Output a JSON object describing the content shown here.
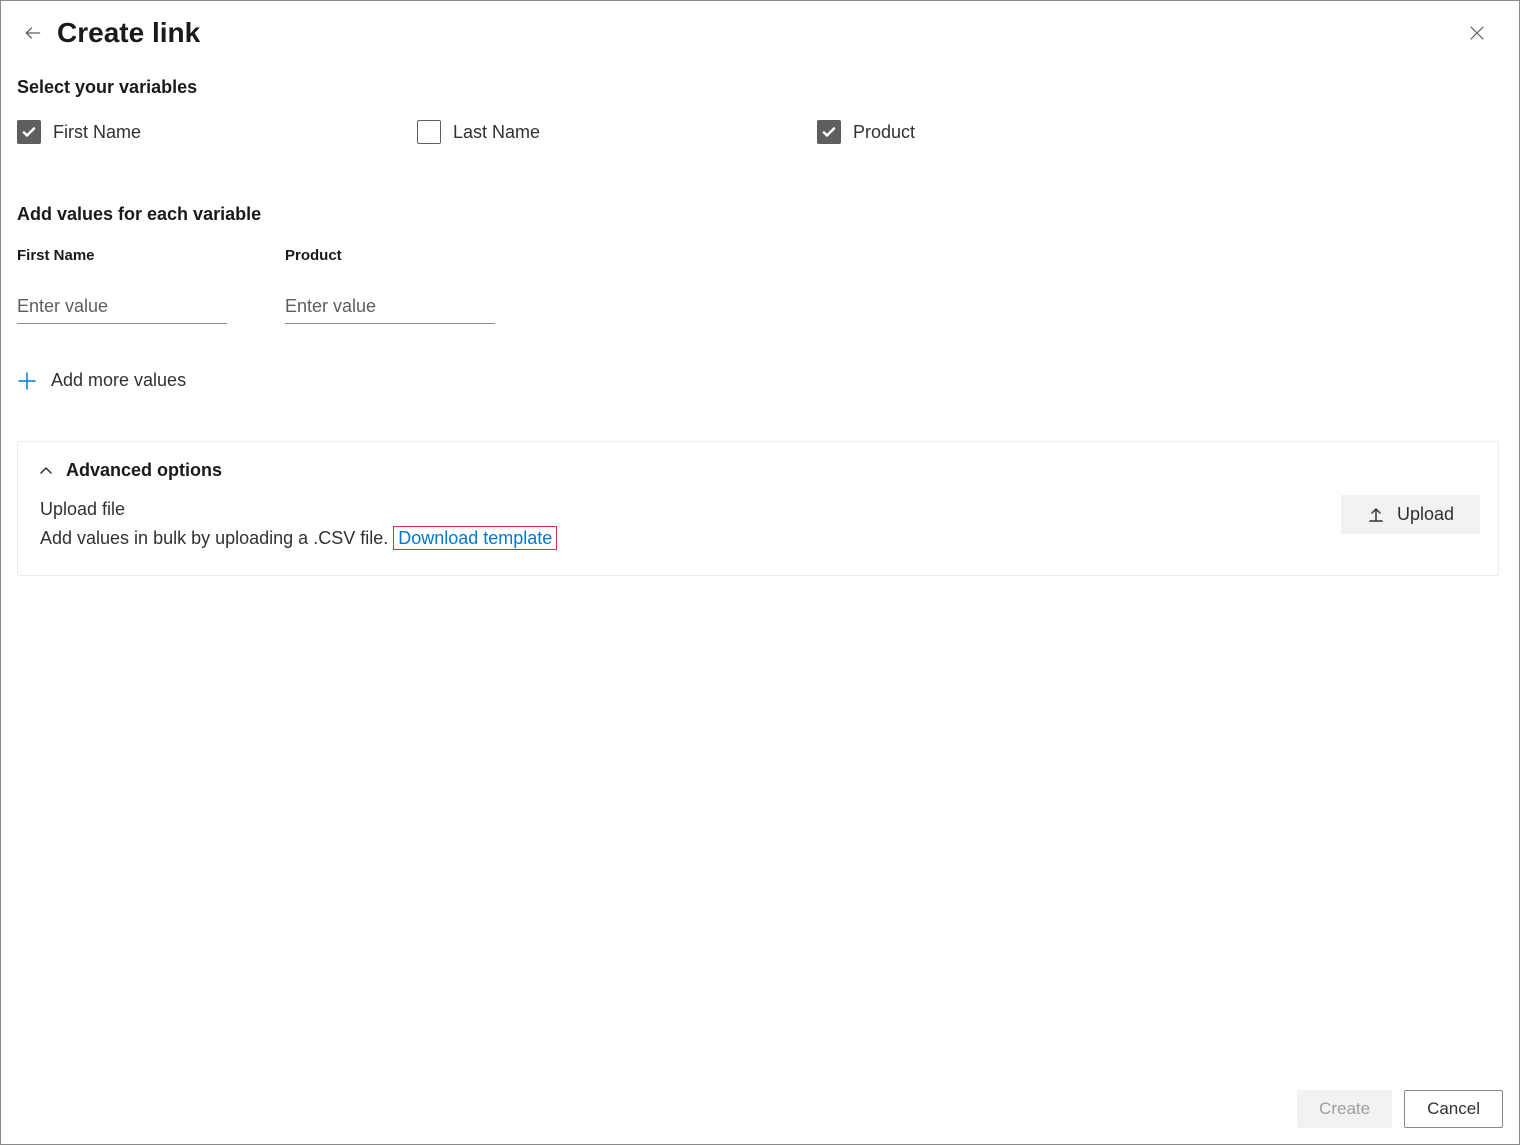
{
  "header": {
    "title": "Create link"
  },
  "variables": {
    "heading": "Select your variables",
    "items": [
      {
        "label": "First Name",
        "checked": true
      },
      {
        "label": "Last Name",
        "checked": false
      },
      {
        "label": "Product",
        "checked": true
      }
    ]
  },
  "values": {
    "heading": "Add values for each variable",
    "fields": [
      {
        "label": "First Name",
        "placeholder": "Enter value"
      },
      {
        "label": "Product",
        "placeholder": "Enter value"
      }
    ],
    "add_more_label": "Add more values"
  },
  "advanced": {
    "title": "Advanced options",
    "upload_title": "Upload file",
    "upload_desc": "Add values in bulk by uploading a .CSV file. ",
    "download_link": "Download template",
    "upload_button": "Upload"
  },
  "footer": {
    "create": "Create",
    "cancel": "Cancel"
  }
}
